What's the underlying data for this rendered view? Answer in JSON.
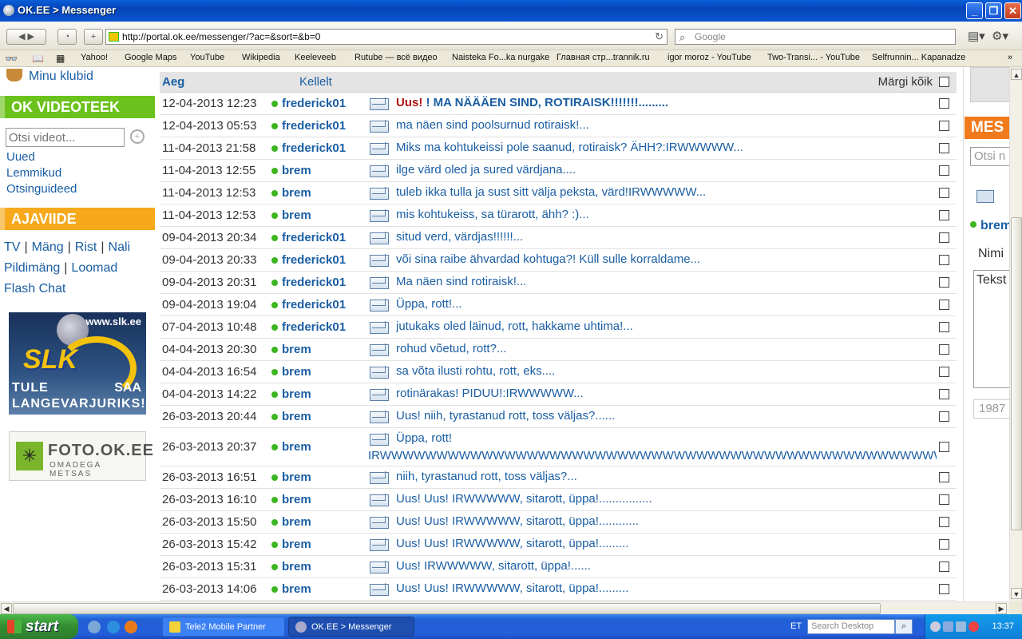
{
  "window": {
    "title": "OK.EE > Messenger"
  },
  "toolbar": {
    "url": "http://portal.ok.ee/messenger/?ac=&sort=&b=0",
    "search_placeholder": "Google"
  },
  "bookmarks": [
    "Yahoo!",
    "Google Maps",
    "YouTube",
    "Wikipedia",
    "Keeleveeb",
    "Rutube — всё видео",
    "Naisteka Fo...ka nurgake",
    "Главная стр...trannik.ru",
    "igor moroz - YouTube",
    "Two-Transi... - YouTube",
    "Selfrunnin... Kapanadze"
  ],
  "left": {
    "club_link": "Minu klubid",
    "videoteek": {
      "heading": "OK VIDEOTEEK",
      "search_placeholder": "Otsi videot...",
      "links": [
        "Uued",
        "Lemmikud",
        "Otsinguideed"
      ]
    },
    "ajaviide": {
      "heading": "AJAVIIDE",
      "line1": [
        "TV",
        "Mäng",
        "Rist",
        "Nali"
      ],
      "line2": [
        "Pildimäng",
        "Loomad"
      ],
      "line3": [
        "Flash Chat"
      ]
    },
    "banner_slk": {
      "site": "www.slk.ee",
      "logo": "SLK",
      "tag1": "TULE",
      "tag2": "SAA",
      "tag3": "LANGEVARJURIKS!"
    },
    "banner_foto": {
      "title": "FOTO.OK.EE",
      "subtitle": "OMADEGA METSAS"
    }
  },
  "messages": {
    "col_time": "Aeg",
    "col_from": "Kellelt",
    "mark_all": "Märgi kõik",
    "new_label": "Uus!",
    "rows": [
      {
        "date": "12-04-2013 12:23",
        "from": "frederick01",
        "subject": " ! MA NÄÄÄEN SIND, ROTIRAISK!!!!!!!.........",
        "new": true
      },
      {
        "date": "12-04-2013 05:53",
        "from": "frederick01",
        "subject": "ma näen sind poolsurnud rotiraisk!..."
      },
      {
        "date": "11-04-2013 21:58",
        "from": "frederick01",
        "subject": "Miks ma kohtukeissi pole saanud, rotiraisk? ÄHH?:IRWWWWW..."
      },
      {
        "date": "11-04-2013 12:55",
        "from": "brem",
        "subject": "ilge värd oled ja sured värdjana...."
      },
      {
        "date": "11-04-2013 12:53",
        "from": "brem",
        "subject": "tuleb ikka tulla ja sust sitt välja peksta, värd!IRWWWWW..."
      },
      {
        "date": "11-04-2013 12:53",
        "from": "brem",
        "subject": "mis kohtukeiss, sa türarott, ähh? :)..."
      },
      {
        "date": "09-04-2013 20:34",
        "from": "frederick01",
        "subject": "situd verd, värdjas!!!!!!..."
      },
      {
        "date": "09-04-2013 20:33",
        "from": "frederick01",
        "subject": "või sina raibe ähvardad kohtuga?! Küll sulle korraldame..."
      },
      {
        "date": "09-04-2013 20:31",
        "from": "frederick01",
        "subject": "Ma näen sind rotiraisk!..."
      },
      {
        "date": "09-04-2013 19:04",
        "from": "frederick01",
        "subject": "Üppa, rott!..."
      },
      {
        "date": "07-04-2013 10:48",
        "from": "frederick01",
        "subject": "jutukaks oled läinud, rott, hakkame uhtima!..."
      },
      {
        "date": "04-04-2013 20:30",
        "from": "brem",
        "subject": "rohud võetud, rott?..."
      },
      {
        "date": "04-04-2013 16:54",
        "from": "brem",
        "subject": "sa võta ilusti rohtu, rott, eks...."
      },
      {
        "date": "04-04-2013 14:22",
        "from": "brem",
        "subject": "rotinärakas! PIDUU!:IRWWWWW..."
      },
      {
        "date": "26-03-2013 20:44",
        "from": "brem",
        "subject": "Uus! niih, tyrastanud rott, toss väljas?......"
      },
      {
        "date": "26-03-2013 20:37",
        "from": "brem",
        "subject": "Üppa, rott!",
        "subject_line2": "IRWWWWWWWWWWWWWWWWWWWWWWWWWWWWWWWWWWWWWWWWWWWWWWWWWWWWWWWWWWWWWWWWWWWW..."
      },
      {
        "date": "26-03-2013 16:51",
        "from": "brem",
        "subject": "niih, tyrastanud rott, toss väljas?..."
      },
      {
        "date": "26-03-2013 16:10",
        "from": "brem",
        "subject": "Uus! Uus! IRWWWWW, sitarott, üppa!................"
      },
      {
        "date": "26-03-2013 15:50",
        "from": "brem",
        "subject": "Uus! Uus! IRWWWWW, sitarott, üppa!............"
      },
      {
        "date": "26-03-2013 15:42",
        "from": "brem",
        "subject": "Uus! Uus! IRWWWWW, sitarott, üppa!........."
      },
      {
        "date": "26-03-2013 15:31",
        "from": "brem",
        "subject": "Uus! IRWWWWW, sitarott, üppa!......"
      },
      {
        "date": "26-03-2013 14:06",
        "from": "brem",
        "subject": "Uus! Uus! IRWWWWW, sitarott, üppa!........."
      }
    ]
  },
  "right": {
    "heading": "MES",
    "search": "Otsi n",
    "user": "brem",
    "name_label": "Nimi",
    "text_label": "Tekst",
    "year": "1987"
  },
  "taskbar": {
    "start": "start",
    "tasks": [
      "Tele2 Mobile Partner",
      "OK.EE > Messenger"
    ],
    "lang": "ET",
    "desktop_search": "Search Desktop",
    "clock": "13:37"
  },
  "colors": {
    "link": "#1a5ea3",
    "green_head": "#6cc21c",
    "orange_head": "#f5a91b",
    "new_red": "#b11212",
    "online": "#3cb521"
  }
}
